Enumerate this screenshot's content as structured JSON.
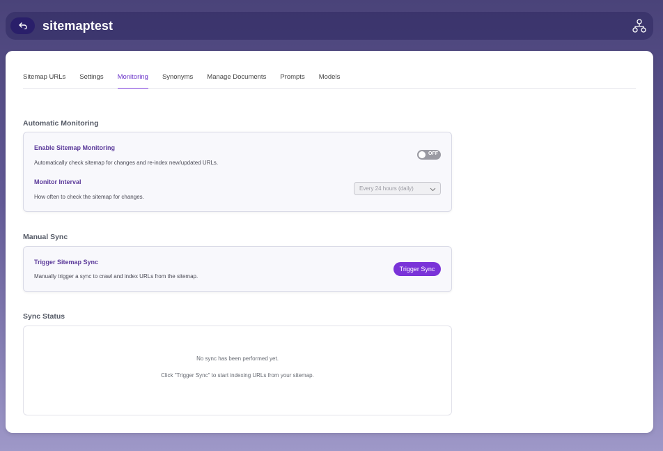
{
  "header": {
    "title": "sitemaptest",
    "back_icon": "back-arrow-icon",
    "sitemap_icon": "sitemap-tree-icon"
  },
  "tabs": [
    {
      "label": "Sitemap URLs"
    },
    {
      "label": "Settings"
    },
    {
      "label": "Monitoring",
      "active": true
    },
    {
      "label": "Synonyms"
    },
    {
      "label": "Manage Documents"
    },
    {
      "label": "Prompts"
    },
    {
      "label": "Models"
    }
  ],
  "automatic_monitoring": {
    "title": "Automatic Monitoring",
    "enable_label": "Enable Sitemap Monitoring",
    "enable_desc": "Automatically check sitemap for changes and re-index new/updated URLs.",
    "toggle_state": "OFF",
    "interval_label": "Monitor Interval",
    "interval_desc": "How often to check the sitemap for changes.",
    "interval_value": "Every 24 hours (daily)"
  },
  "manual_sync": {
    "title": "Manual Sync",
    "trigger_label": "Trigger Sitemap Sync",
    "trigger_desc": "Manually trigger a sync to crawl and index URLs from the sitemap.",
    "button_label": "Trigger Sync"
  },
  "sync_status": {
    "title": "Sync Status",
    "line1": "No sync has been performed yet.",
    "line2": "Click \"Trigger Sync\" to start indexing URLs from your sitemap."
  },
  "colors": {
    "accent": "#7a33d8",
    "active_tab": "#6b35c9",
    "toggle_off": "#9a9aa2"
  }
}
